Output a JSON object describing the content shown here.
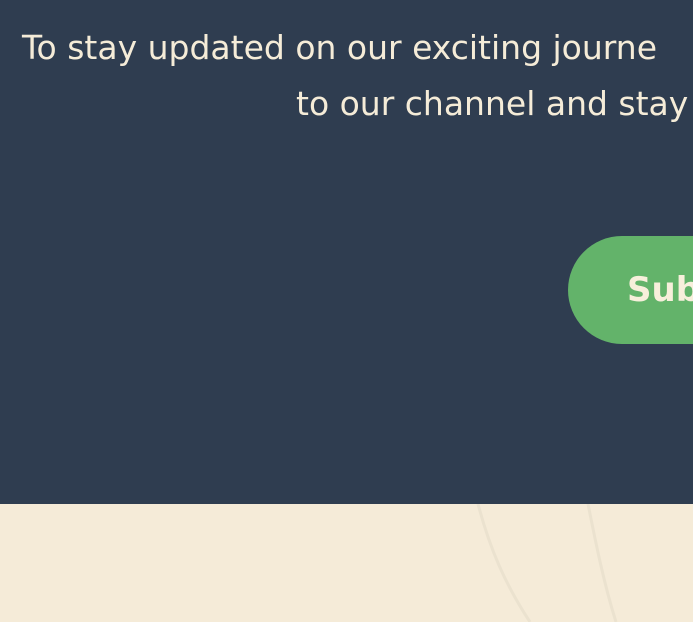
{
  "cta": {
    "message_line_1": "To stay updated on our exciting journe",
    "message_line_2": "to our channel and stay",
    "subscribe_label": "Subscribe"
  },
  "colors": {
    "section_background": "#2f3d50",
    "text": "#f5ecd8",
    "button_background": "#63b36a",
    "footer_background": "#f5ebd8"
  }
}
